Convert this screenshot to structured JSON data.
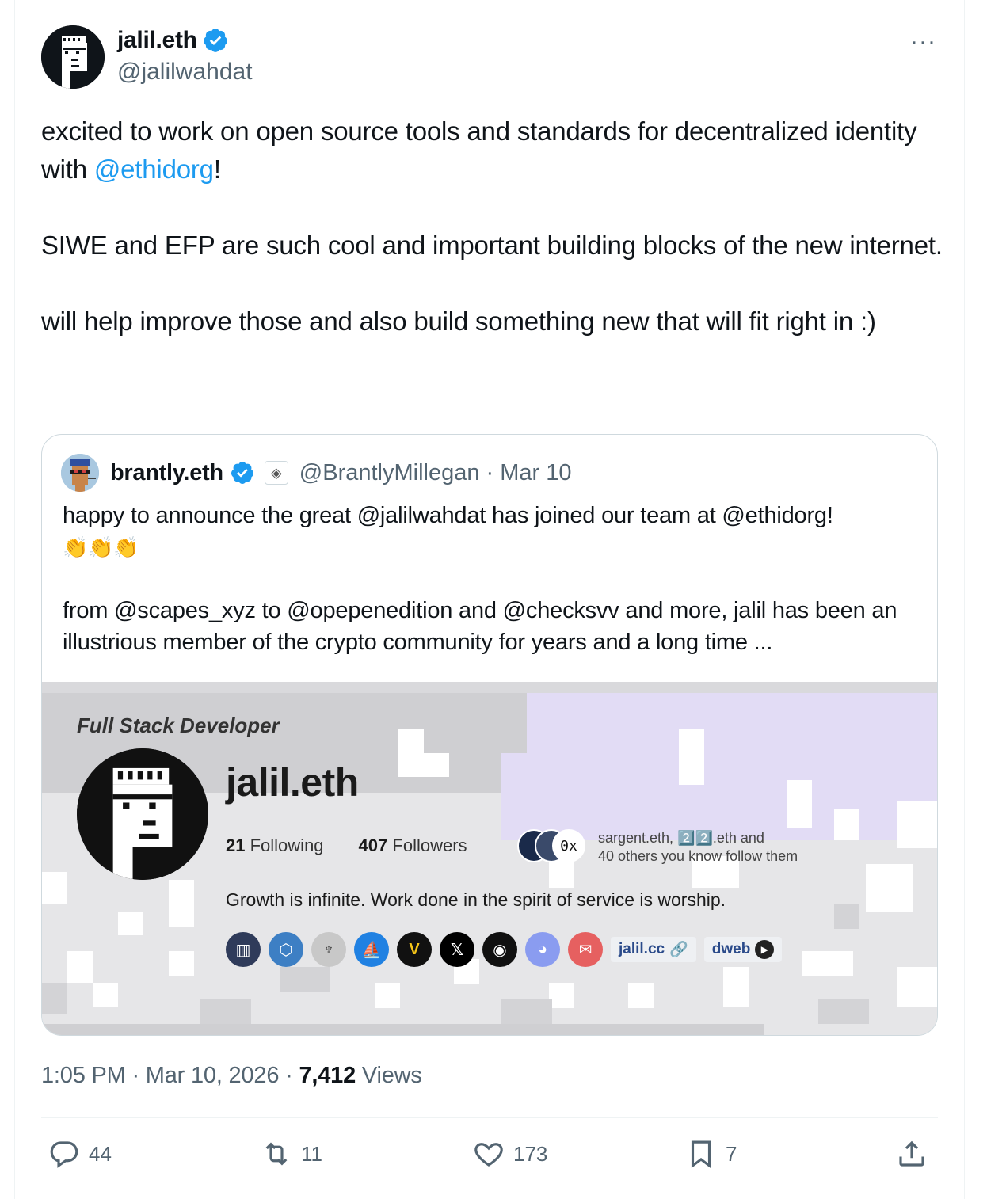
{
  "tweet": {
    "author_name": "jalil.eth",
    "author_handle": "@jalilwahdat",
    "more_label": "···",
    "text": {
      "p1_a": "excited to work on open source tools and standards for decentralized identity with ",
      "p1_mention": "@ethidorg",
      "p1_b": "!",
      "p2": "SIWE and EFP are such cool and important building blocks of the new internet.",
      "p3": "will help improve those and also build something new that will fit right in :)"
    },
    "timestamp": "1:05 PM · Mar 10, 2026 · ",
    "views_count": "7,412",
    "views_label": " Views"
  },
  "quote": {
    "author_name": "brantly.eth",
    "badge_icon": "ethereum-icon",
    "handle_date": "@BrantlyMillegan · Mar 10",
    "line1": "happy to announce the great @jalilwahdat has joined our team at @ethidorg!",
    "claps": "👏👏👏",
    "line2": "from @scapes_xyz to @opepenedition and @checksvv and more, jalil has been an illustrious member of the crypto community for years and a long time ...",
    "image": {
      "role": "Full Stack Developer",
      "name": "jalil.eth",
      "following_count": "21",
      "following_label": "Following",
      "followers_count": "407",
      "followers_label": "Followers",
      "mutual_badge": "0x",
      "mutual_line1": "sargent.eth, 2️⃣2️⃣.eth and",
      "mutual_line2": "40 others you know follow them",
      "bio": "Growth is infinite. Work done in the spirit of service is worship.",
      "link1": "jalil.cc",
      "link2": "dweb"
    }
  },
  "actions": {
    "replies": "44",
    "reposts": "11",
    "likes": "173",
    "bookmarks": "7"
  },
  "colors": {
    "accent": "#1d9bf0",
    "muted": "#536471",
    "text": "#0f1419"
  }
}
